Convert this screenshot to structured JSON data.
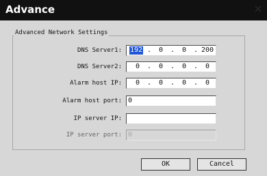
{
  "window": {
    "title": "Advance",
    "close_icon": "close-icon"
  },
  "group": {
    "title": "Advanced Network Settings"
  },
  "fields": [
    {
      "label": "DNS Server1:",
      "octets": [
        "192",
        "0",
        "0",
        "200"
      ],
      "selected_octet": "192"
    },
    {
      "label": "DNS Server2:",
      "octets": [
        "0",
        "0",
        "0",
        "0"
      ]
    },
    {
      "label": "Alarm host IP:",
      "octets": [
        "0",
        "0",
        "0",
        "0"
      ]
    },
    {
      "label": "Alarm host port:",
      "value": "0"
    },
    {
      "label": "IP server IP:",
      "value": ""
    },
    {
      "label": "IP server port:",
      "value": "0",
      "enabled": false
    }
  ],
  "separators": {
    "dot": "."
  },
  "buttons": {
    "ok": "OK",
    "cancel": "Cancel"
  },
  "colors": {
    "titlebar": "#111111",
    "dialog": "#d7d7d7",
    "selection": "#1f55d6"
  }
}
